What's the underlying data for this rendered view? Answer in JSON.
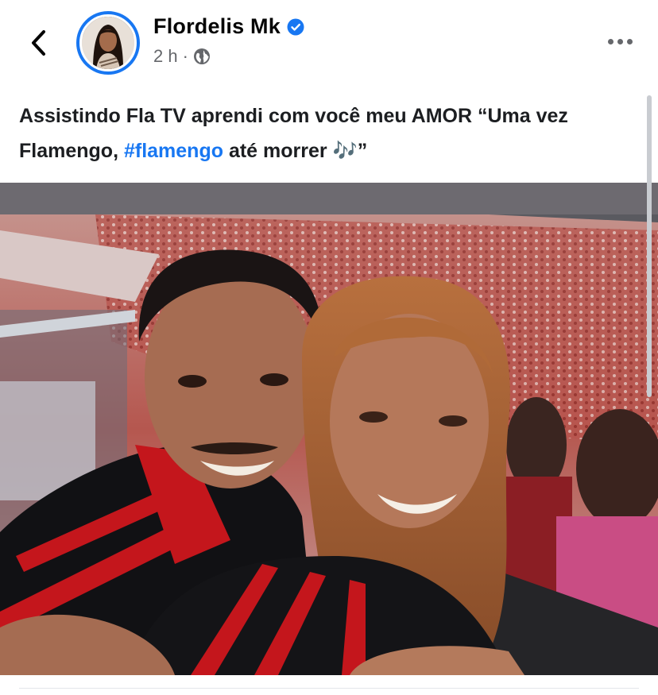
{
  "header": {
    "back_icon": "chevron-left-icon",
    "author_name": "Flordelis Mk",
    "verified_icon": "verified-badge-icon",
    "time": "2 h",
    "separator": "·",
    "privacy_icon": "globe-icon",
    "more_icon": "more-horizontal-icon"
  },
  "post": {
    "text_before": "Assistindo Fla TV aprendi com você meu AMOR “Uma vez Flamengo, ",
    "hashtag": "#flamengo",
    "text_after": " até morrer 🎶”"
  },
  "photo": {
    "description_icon": "post-photo"
  },
  "colors": {
    "accent": "#1877f2",
    "secondary_text": "#65676b",
    "text": "#1c1e21"
  }
}
